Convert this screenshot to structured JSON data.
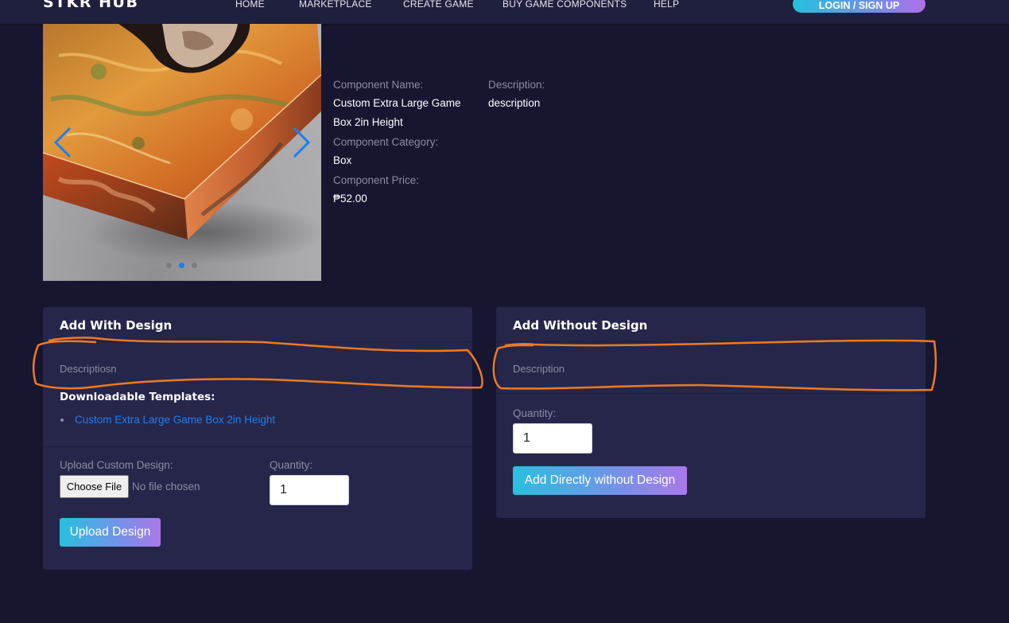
{
  "nav": {
    "brand": "STKR HUB",
    "links": [
      "HOME",
      "MARKETPLACE",
      "CREATE GAME",
      "BUY GAME COMPONENTS",
      "HELP"
    ],
    "login_label": "LOGIN / SIGN UP"
  },
  "carousel": {
    "slide_count": 3,
    "active_slide": 2,
    "prev_icon": "chevron-left-icon",
    "next_icon": "chevron-right-icon"
  },
  "details": {
    "name_label": "Component Name:",
    "name_line1": "Custom Extra Large Game",
    "name_line2": "Box 2in Height",
    "category_label": "Component Category:",
    "category_value": "Box",
    "price_label": "Component Price:",
    "price_value": "₱52.00",
    "description_label": "Description:",
    "description_value": "description"
  },
  "with_design": {
    "title": "Add With Design",
    "description": "Descriptiosn",
    "templates_title": "Downloadable Templates:",
    "template_link": "Custom Extra Large Game Box 2in Height",
    "upload_label": "Upload Custom Design:",
    "choose_file_label": "Choose File",
    "file_status": "No file chosen",
    "quantity_label": "Quantity:",
    "quantity_value": "1",
    "upload_button": "Upload Design"
  },
  "without_design": {
    "title": "Add Without Design",
    "description": "Description",
    "quantity_label": "Quantity:",
    "quantity_value": "1",
    "add_button": "Add Directly without Design"
  },
  "colors": {
    "page_bg": "#161631",
    "card_bg": "#26264b",
    "nav_bg": "#1f1f3e",
    "accent_link": "#1d7ff0",
    "annotation": "#f07a1e"
  }
}
